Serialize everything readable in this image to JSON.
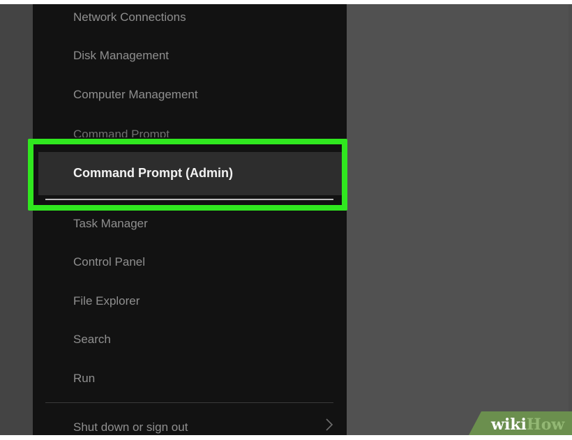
{
  "menu": {
    "items": [
      {
        "label": "Network Connections"
      },
      {
        "label": "Disk Management"
      },
      {
        "label": "Computer Management"
      },
      {
        "label": "Command Prompt"
      },
      {
        "label": "Command Prompt (Admin)"
      },
      {
        "label": "Task Manager"
      },
      {
        "label": "Control Panel"
      },
      {
        "label": "File Explorer"
      },
      {
        "label": "Search"
      },
      {
        "label": "Run"
      },
      {
        "label": "Shut down or sign out"
      }
    ],
    "selected_index": 4
  },
  "watermark": {
    "prefix": "wiki",
    "suffix": "How"
  },
  "colors": {
    "highlight_outline": "#30e81f",
    "menu_bg": "#121212",
    "desktop_bg": "#515151",
    "watermark_green": "#93b874"
  },
  "icons": {
    "submenu": "chevron-right-icon"
  }
}
